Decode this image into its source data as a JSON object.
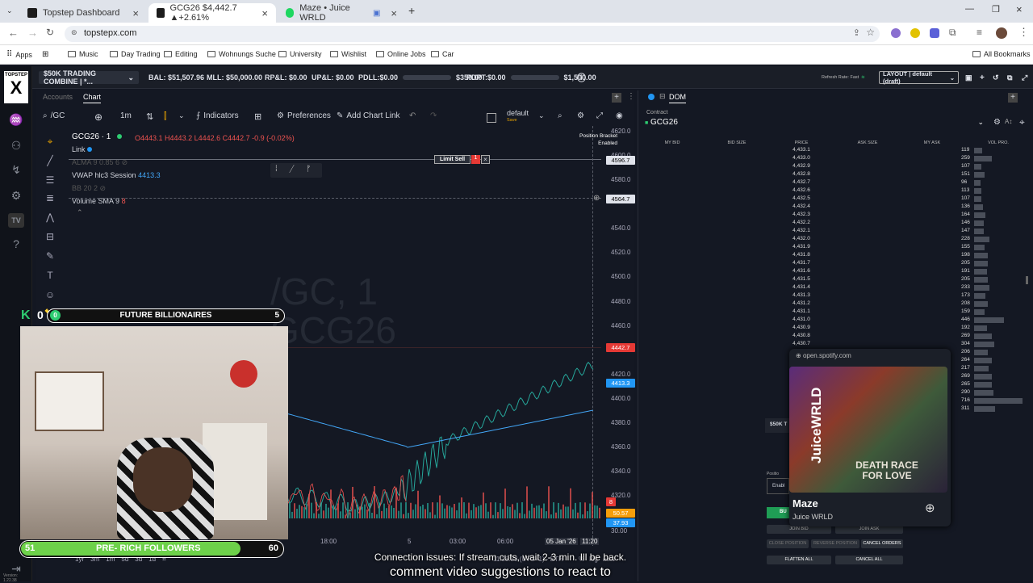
{
  "browser": {
    "tabs": [
      {
        "label": "Topstep Dashboard",
        "color": "#1c1c1c"
      },
      {
        "label": "GCG26 $4,442.7 ▲+2.61%",
        "color": "#1c1c1c"
      },
      {
        "label": "Maze • Juice WRLD",
        "color": "#1ed760"
      }
    ],
    "url": "topstepx.com",
    "bookmarks": [
      "Apps",
      "Music",
      "Day Trading",
      "Editing",
      "Wohnungs Suche",
      "University",
      "Wishlist",
      "Online Jobs",
      "Car"
    ],
    "all_bookmarks": "All Bookmarks"
  },
  "topbar": {
    "account": "$50K TRADING COMBINE | *...",
    "bal": "BAL: $51,507.96",
    "mll": "MLL: $50,000.00",
    "rpl": "RP&L: $0.00",
    "upl": "UP&L: $0.00",
    "pdll": "PDLL:$0.00",
    "pdll_max": "$350.00",
    "pdpt": "PDPT:$0.00",
    "pdpt_max": "$1,500.00",
    "refresh": "Refresh Rate: Fast",
    "layout": "LAYOUT | default (draft)"
  },
  "chart": {
    "tabs": [
      "Accounts",
      "Chart"
    ],
    "symbol": "/GC",
    "interval": "1m",
    "indicators": "Indicators",
    "preferences": "Preferences",
    "add_chart_link": "Add Chart Link",
    "template": "default",
    "template_save": "Save",
    "title": "GCG26 · 1",
    "o": "4443.1",
    "h": "4443.2",
    "l": "4442.6",
    "c": "4442.7",
    "chg": "-0.9 (-0.02%)",
    "link": "Link",
    "alma": "ALMA 9 0.85 6",
    "vwap": "VWAP hlc3 Session",
    "vwap_val": "4413.3",
    "bb": "BB 20 2",
    "volume": "Volume SMA 9",
    "volume_val": "8",
    "watermark1": "/GC, 1",
    "watermark2": "GCG26",
    "limit_sell": "Limit Sell",
    "position_bracket": "Position Bracket",
    "position_bracket_state": "Enabled",
    "price_ticks": [
      "4620.0",
      "4600.0",
      "4580.0",
      "4560.0",
      "4540.0",
      "4520.0",
      "4500.0",
      "4480.0",
      "4460.0",
      "4440.0",
      "4420.0",
      "4400.0",
      "4380.0",
      "4360.0",
      "4340.0",
      "4320.0",
      "30.00"
    ],
    "limit_price": "4596.7",
    "crosshair_price": "4564.7",
    "last_price": "4442.7",
    "vwap_price": "4413.3",
    "vol_tags": [
      "8",
      "50.57",
      "37.93"
    ],
    "time_ticks": [
      "18:00",
      "5",
      "03:00",
      "06:00"
    ],
    "time_current": "05 Jan '26",
    "time_clock": "11:20",
    "timezone": "11:18:38 (UTC+1)",
    "session": "ETH",
    "ranges": [
      "1yr",
      "3m",
      "1m",
      "5d",
      "3d",
      "1d"
    ],
    "scale_opts": [
      "%",
      "log",
      "auto"
    ],
    "version": "Version: 1.22.38"
  },
  "dom": {
    "title": "DOM",
    "contract_label": "Contract",
    "contract": "GCG26",
    "columns": [
      "MY BID",
      "BID SIZE",
      "PRICE",
      "ASK SIZE",
      "MY ASK",
      "VOL PRO."
    ],
    "rows": [
      {
        "price": "4,433.1",
        "vol": "119"
      },
      {
        "price": "4,433.0",
        "vol": "259"
      },
      {
        "price": "4,432.9",
        "vol": "107"
      },
      {
        "price": "4,432.8",
        "vol": "151"
      },
      {
        "price": "4,432.7",
        "vol": "96"
      },
      {
        "price": "4,432.6",
        "vol": "113"
      },
      {
        "price": "4,432.5",
        "vol": "107"
      },
      {
        "price": "4,432.4",
        "vol": "136"
      },
      {
        "price": "4,432.3",
        "vol": "164"
      },
      {
        "price": "4,432.2",
        "vol": "146"
      },
      {
        "price": "4,432.1",
        "vol": "147"
      },
      {
        "price": "4,432.0",
        "vol": "228"
      },
      {
        "price": "4,431.9",
        "vol": "155"
      },
      {
        "price": "4,431.8",
        "vol": "198"
      },
      {
        "price": "4,431.7",
        "vol": "205"
      },
      {
        "price": "4,431.6",
        "vol": "191"
      },
      {
        "price": "4,431.5",
        "vol": "205"
      },
      {
        "price": "4,431.4",
        "vol": "233"
      },
      {
        "price": "4,431.3",
        "vol": "173"
      },
      {
        "price": "4,431.2",
        "vol": "208"
      },
      {
        "price": "4,431.1",
        "vol": "159"
      },
      {
        "price": "4,431.0",
        "vol": "446"
      },
      {
        "price": "4,430.9",
        "vol": "192"
      },
      {
        "price": "4,430.8",
        "vol": "269"
      },
      {
        "price": "4,430.7",
        "vol": "304"
      },
      {
        "price": "",
        "vol": "206"
      },
      {
        "price": "",
        "vol": "264"
      },
      {
        "price": "",
        "vol": "217"
      },
      {
        "price": "",
        "vol": "269"
      },
      {
        "price": "",
        "vol": "265"
      },
      {
        "price": "",
        "vol": "290"
      },
      {
        "price": "",
        "vol": "716"
      },
      {
        "price": "",
        "vol": "311"
      }
    ],
    "buttons": {
      "join_bid": "JOIN BID",
      "join_ask": "JOIN ASK",
      "close_position": "CLOSE POSITION",
      "reverse_position": "REVERSE POSITION",
      "cancel_orders": "CANCEL ORDERS",
      "flatten_all": "FLATTEN ALL",
      "cancel_all": "CANCEL ALL"
    },
    "partial_labels": [
      "$50K T",
      "Positio",
      "Enabl",
      "BU"
    ]
  },
  "spotify": {
    "host": "open.spotify.com",
    "track": "Maze",
    "artist": "Juice WRLD",
    "album_side": "JuiceWRLD",
    "album_title1": "DEATH RACE",
    "album_title2": "FOR LOVE"
  },
  "stream": {
    "future_label": "FUTURE BILLIONAIRES",
    "future_left": "0",
    "future_right": "5",
    "k_count": "0",
    "prf_label": "PRE- RICH FOLLOWERS",
    "prf_left": "51",
    "prf_right": "60",
    "caption1": "Connection issues: If stream cuts, wait 2-3 min. Ill be back.",
    "caption2": "comment video suggestions to react to"
  }
}
